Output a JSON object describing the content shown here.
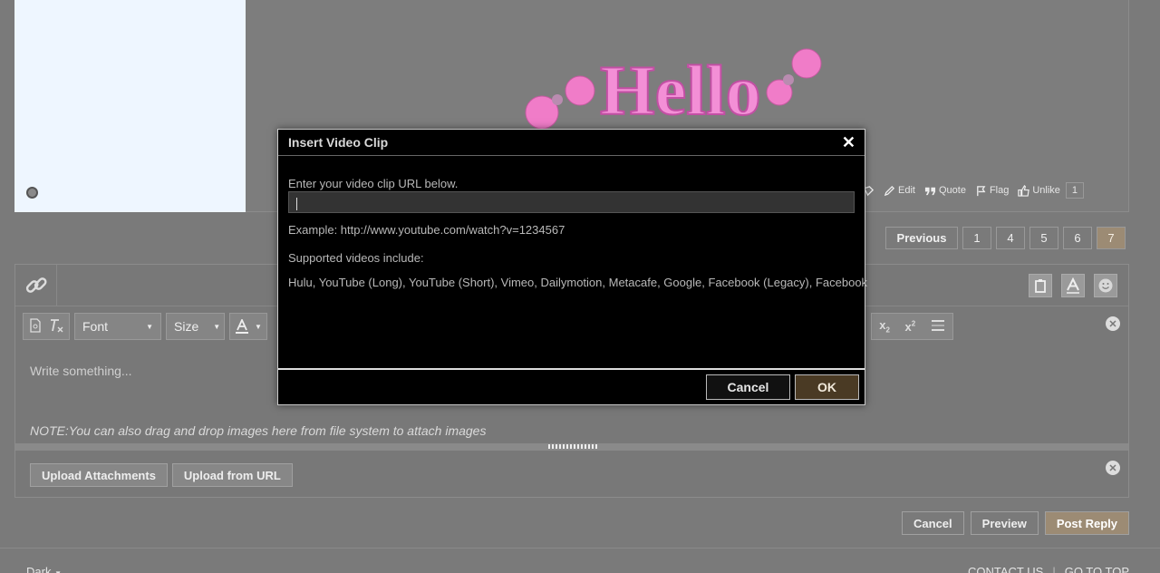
{
  "post": {
    "actions": [
      {
        "label": "Edit",
        "icon": "pencil-icon"
      },
      {
        "label": "Quote",
        "icon": "quote-icon"
      },
      {
        "label": "Flag",
        "icon": "flag-icon"
      },
      {
        "label": "Unlike",
        "icon": "thumbs-up-icon"
      }
    ],
    "like_count": "1",
    "image_text": "Hello"
  },
  "pager": {
    "previous_label": "Previous",
    "pages": [
      "1",
      "4",
      "5",
      "6",
      "7"
    ],
    "current": "7"
  },
  "editor": {
    "font_label": "Font",
    "size_label": "Size",
    "placeholder": "Write something...",
    "note": "NOTE:You can also drag and drop images here from file system to attach images",
    "upload_attachments_label": "Upload Attachments",
    "upload_url_label": "Upload from URL"
  },
  "actions": {
    "cancel_label": "Cancel",
    "preview_label": "Preview",
    "post_reply_label": "Post Reply"
  },
  "footer": {
    "theme_label": "Dark",
    "contact_label": "CONTACT US",
    "top_label": "GO TO TOP"
  },
  "modal": {
    "title": "Insert Video Clip",
    "url_label": "Enter your video clip URL below.",
    "url_value": "",
    "example": "Example: http://www.youtube.com/watch?v=1234567",
    "supported_label": "Supported videos include:",
    "providers": "Hulu, YouTube (Long), YouTube (Short), Vimeo, Dailymotion, Metacafe, Google, Facebook (Legacy), Facebook",
    "cancel_label": "Cancel",
    "ok_label": "OK"
  },
  "colors": {
    "accent": "#9c8b74",
    "ok_button": "#4a3a24",
    "modal_bg": "#000000",
    "overlay": "#7a7a7a"
  }
}
